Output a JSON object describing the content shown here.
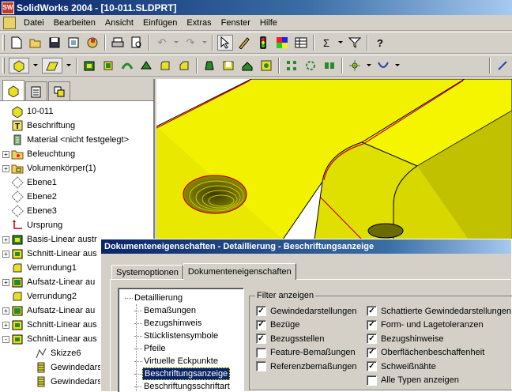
{
  "window": {
    "title": "SolidWorks 2004 - [10-011.SLDPRT]",
    "app_icon_text": "SW"
  },
  "menu": [
    "Datei",
    "Bearbeiten",
    "Ansicht",
    "Einfügen",
    "Extras",
    "Fenster",
    "Hilfe"
  ],
  "toolbar1": {
    "undo_glyph": "↶",
    "redo_glyph": "↷",
    "sigma_glyph": "Σ",
    "help_glyph": "?"
  },
  "feature_tree": {
    "items": [
      {
        "label": "10-011",
        "expander": "",
        "icon": "part-icon"
      },
      {
        "label": "Beschriftung",
        "expander": "",
        "icon": "annotation-icon"
      },
      {
        "label": "Material <nicht festgelegt>",
        "expander": "",
        "icon": "material-icon"
      },
      {
        "label": "Beleuchtung",
        "expander": "+",
        "icon": "lighting-folder-icon"
      },
      {
        "label": "Volumenkörper(1)",
        "expander": "+",
        "icon": "solid-bodies-folder-icon"
      },
      {
        "label": "Ebene1",
        "expander": "",
        "icon": "plane-icon"
      },
      {
        "label": "Ebene2",
        "expander": "",
        "icon": "plane-icon"
      },
      {
        "label": "Ebene3",
        "expander": "",
        "icon": "plane-icon"
      },
      {
        "label": "Ursprung",
        "expander": "",
        "icon": "origin-icon"
      },
      {
        "label": "Basis-Linear austr",
        "expander": "+",
        "icon": "extrude-icon"
      },
      {
        "label": "Schnitt-Linear aus",
        "expander": "+",
        "icon": "cut-extrude-icon"
      },
      {
        "label": "Verrundung1",
        "expander": "",
        "icon": "fillet-icon"
      },
      {
        "label": "Aufsatz-Linear au",
        "expander": "+",
        "icon": "boss-extrude-icon"
      },
      {
        "label": "Verrundung2",
        "expander": "",
        "icon": "fillet-icon"
      },
      {
        "label": "Aufsatz-Linear au",
        "expander": "+",
        "icon": "boss-extrude-icon"
      },
      {
        "label": "Schnitt-Linear aus",
        "expander": "+",
        "icon": "cut-extrude-icon"
      },
      {
        "label": "Schnitt-Linear aus",
        "expander": "-",
        "icon": "cut-extrude-icon"
      },
      {
        "label": "Skizze6",
        "expander": "",
        "icon": "sketch-icon",
        "indent": 1
      },
      {
        "label": "Gewindedarst",
        "expander": "",
        "icon": "cosmetic-thread-icon",
        "indent": 1
      },
      {
        "label": "Gewindedarst",
        "expander": "",
        "icon": "cosmetic-thread-icon",
        "indent": 1
      }
    ]
  },
  "dialog": {
    "title": "Dokumenteneigenschaften - Detaillierung - Beschriftungsanzeige",
    "tabs": [
      "Systemoptionen",
      "Dokumenteneigenschaften"
    ],
    "active_tab": "Dokumenteneigenschaften",
    "categories": [
      {
        "label": "Detaillierung",
        "level": 0
      },
      {
        "label": "Bemaßungen",
        "level": 1
      },
      {
        "label": "Bezugshinweis",
        "level": 1
      },
      {
        "label": "Stücklistensymbole",
        "level": 1
      },
      {
        "label": "Pfeile",
        "level": 1
      },
      {
        "label": "Virtuelle Eckpunkte",
        "level": 1
      },
      {
        "label": "Beschriftungsanzeige",
        "level": 1,
        "selected": true
      },
      {
        "label": "Beschriftungsschriftart",
        "level": 1
      }
    ],
    "filter": {
      "legend": "Filter anzeigen",
      "left": [
        {
          "label": "Gewindedarstellungen",
          "checked": true
        },
        {
          "label": "Bezüge",
          "checked": true
        },
        {
          "label": "Bezugsstellen",
          "checked": true
        },
        {
          "label": "Feature-Bemaßungen",
          "checked": false
        },
        {
          "label": "Referenzbemaßungen",
          "checked": false
        }
      ],
      "right": [
        {
          "label": "Schattierte Gewindedarstellungen",
          "checked": true
        },
        {
          "label": "Form- und Lagetoleranzen",
          "checked": true
        },
        {
          "label": "Bezugshinweise",
          "checked": true
        },
        {
          "label": "Oberflächenbeschaffenheit",
          "checked": true
        },
        {
          "label": "Schweißnähte",
          "checked": true
        },
        {
          "label": "Alle Typen anzeigen",
          "checked": false
        }
      ]
    }
  },
  "colors": {
    "part_yellow": "#ffff00",
    "part_dark": "#b8b800",
    "edge": "#cc0000",
    "selection": "#0a246a"
  }
}
